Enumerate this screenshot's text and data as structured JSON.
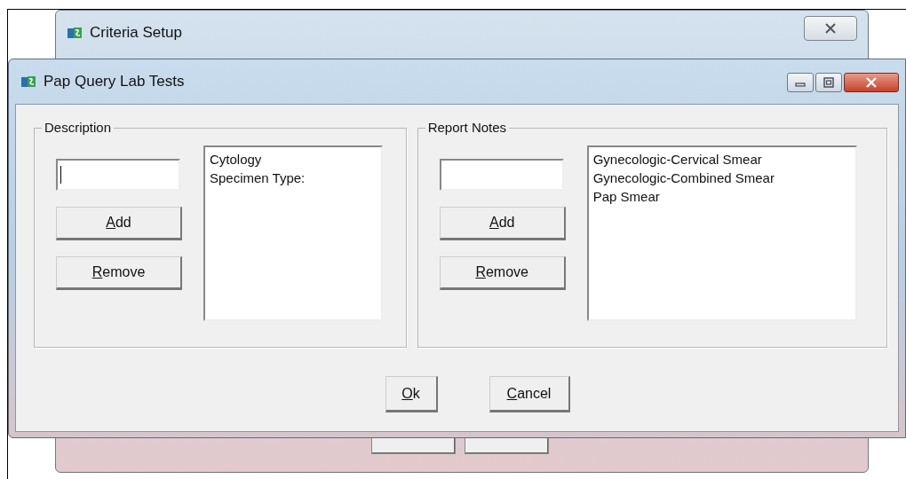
{
  "background_window": {
    "title": "Criteria Setup"
  },
  "dialog": {
    "title": "Pap Query Lab Tests",
    "panels": [
      {
        "title": "Description",
        "field": {
          "focused": true
        },
        "buttons": [
          {
            "label": "Add",
            "mnemonic": true
          },
          {
            "label": "Remove",
            "mnemonic": true
          }
        ],
        "list": [
          "Cytology",
          "Specimen Type:"
        ]
      },
      {
        "title": "Report Notes",
        "field": {
          "focused": false
        },
        "buttons": [
          {
            "label": "Add",
            "mnemonic": true
          },
          {
            "label": "Remove",
            "mnemonic": true
          }
        ],
        "list": [
          "Gynecologic-Cervical Smear",
          "Gynecologic-Combined Smear",
          "Pap Smear"
        ]
      }
    ],
    "buttons": [
      {
        "label": "Ok",
        "mnemonic": true
      },
      {
        "label": "Cancel",
        "mnemonic": true
      }
    ]
  }
}
